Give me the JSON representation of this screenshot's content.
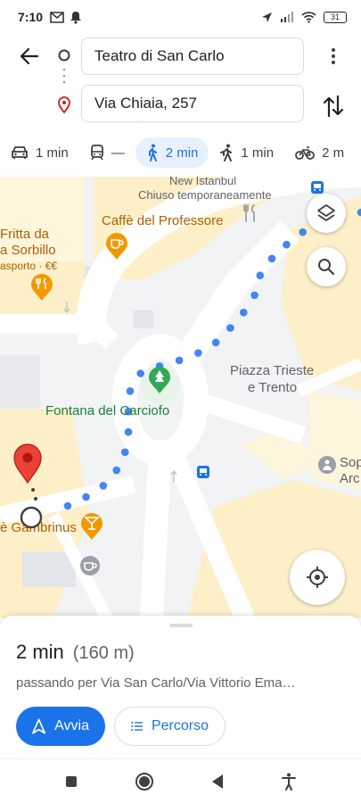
{
  "status_bar": {
    "time": "7:10",
    "battery": "31"
  },
  "search": {
    "origin": "Teatro di San Carlo",
    "destination": "Via Chiaia, 257"
  },
  "modes": [
    {
      "icon": "car-icon",
      "label": "1 min"
    },
    {
      "icon": "transit-icon",
      "label": "—"
    },
    {
      "icon": "walk-icon",
      "label": "2 min",
      "active": true
    },
    {
      "icon": "ride-icon",
      "label": "1 min"
    },
    {
      "icon": "bike-icon",
      "label": "2 m"
    }
  ],
  "map": {
    "labels": {
      "new_istanbul": "New Istanbul",
      "closed": "Chiuso temporaneamente",
      "caffe": "Caffè del Professore",
      "fritta_1": "Fritta da",
      "fritta_2": "a Sorbillo",
      "fritta_3": "asporto · €€",
      "piazza_1": "Piazza Trieste",
      "piazza_2": "e Trento",
      "fontana": "Fontana del Carciofo",
      "sop_1": "Sop",
      "sop_2": "Arc",
      "gambrinus": "è Gambrinus"
    },
    "route_color": "#4285f4",
    "destination_pin_color": "#ea4335"
  },
  "sheet": {
    "duration": "2 min",
    "distance": "(160 m)",
    "via": "passando per Via San Carlo/Via Vittorio Ema…",
    "start_label": "Avvia",
    "steps_label": "Percorso"
  },
  "colors": {
    "accent": "#1a73e8",
    "accent_bg": "#e8f0fe"
  }
}
